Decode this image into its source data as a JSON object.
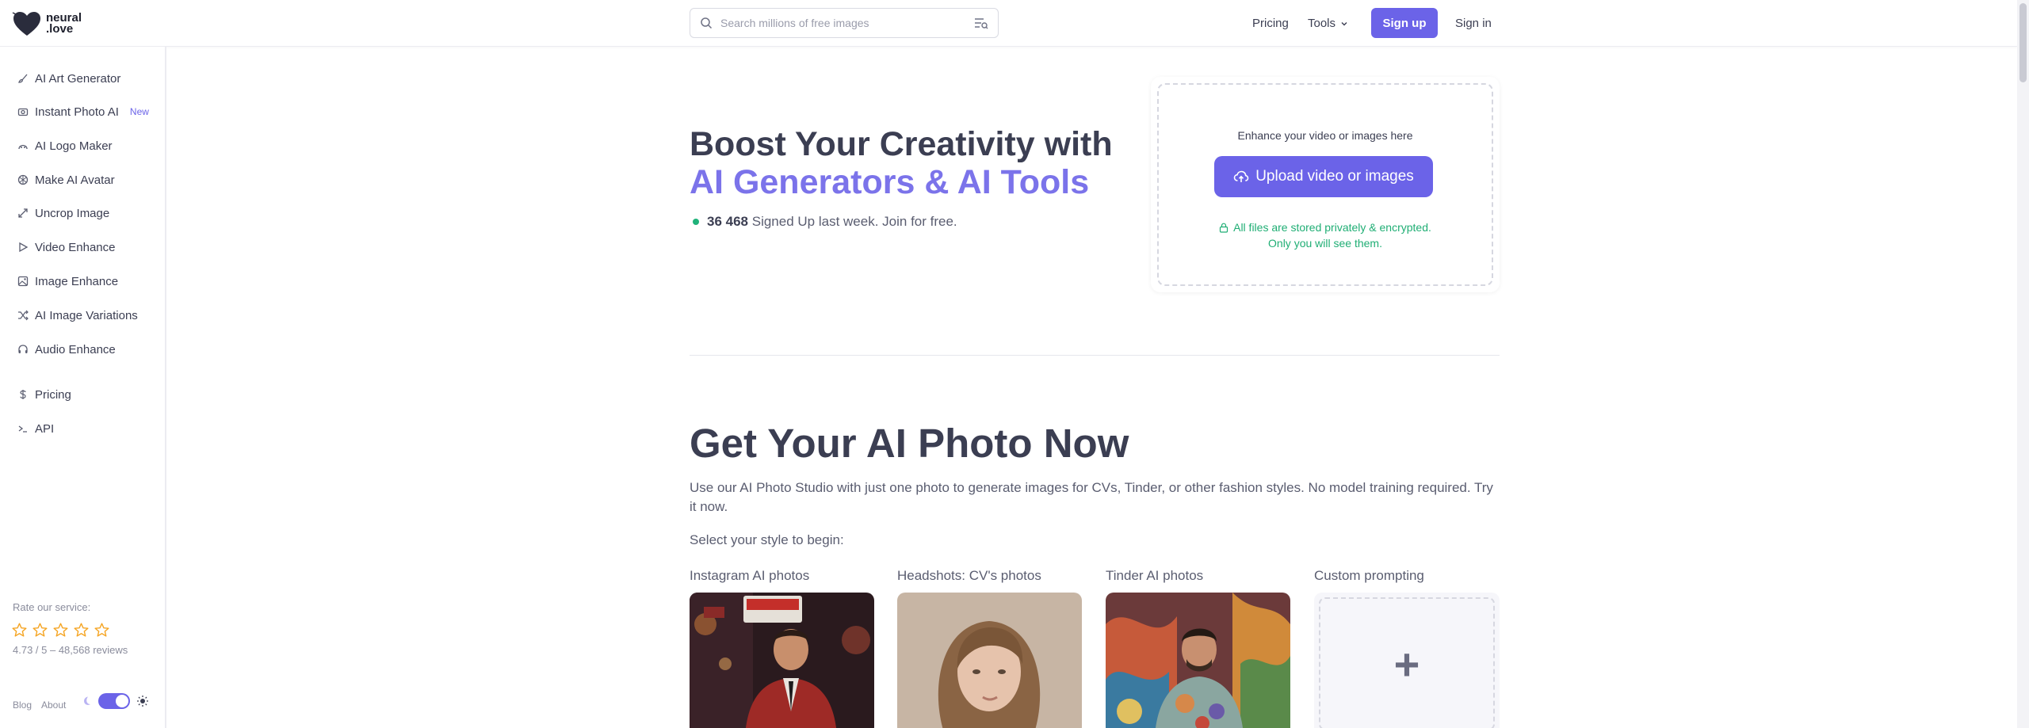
{
  "header": {
    "logo_line1": "neural",
    "logo_line2": ".love",
    "search_placeholder": "Search millions of free images",
    "pricing": "Pricing",
    "tools": "Tools",
    "signup": "Sign up",
    "signin": "Sign in"
  },
  "sidebar": {
    "items": [
      {
        "label": "AI Art Generator",
        "icon": "brush-icon"
      },
      {
        "label": "Instant Photo AI",
        "icon": "camera-icon",
        "badge": "New"
      },
      {
        "label": "AI Logo Maker",
        "icon": "logo-icon"
      },
      {
        "label": "Make AI Avatar",
        "icon": "avatar-icon"
      },
      {
        "label": "Uncrop Image",
        "icon": "expand-icon"
      },
      {
        "label": "Video Enhance",
        "icon": "play-icon"
      },
      {
        "label": "Image Enhance",
        "icon": "image-icon"
      },
      {
        "label": "AI Image Variations",
        "icon": "shuffle-icon"
      },
      {
        "label": "Audio Enhance",
        "icon": "headphones-icon"
      },
      {
        "label": "Pricing",
        "icon": "dollar-icon"
      },
      {
        "label": "API",
        "icon": "terminal-icon"
      }
    ],
    "rate_label": "Rate our service:",
    "rating_text": "4.73 / 5 – 48,568 reviews",
    "rating_stars_total": 5,
    "blog": "Blog",
    "about": "About"
  },
  "hero": {
    "title_line1": "Boost Your Creativity with",
    "title_line2": "AI Generators & AI Tools",
    "signup_count": "36 468",
    "signup_text": "Signed Up last week. Join for free."
  },
  "upload": {
    "hint": "Enhance your video or images here",
    "button": "Upload video or images",
    "privacy_line1": "All files are stored privately & encrypted.",
    "privacy_line2": "Only you will see them."
  },
  "photo_section": {
    "title": "Get Your AI Photo Now",
    "description": "Use our AI Photo Studio with just one photo to generate images for CVs, Tinder, or other fashion styles. No model training required. Try it now.",
    "select_prompt": "Select your style to begin:",
    "cards": [
      {
        "label": "Instagram AI photos"
      },
      {
        "label": "Headshots: CV's photos"
      },
      {
        "label": "Tinder AI photos"
      },
      {
        "label": "Custom prompting",
        "symbol": "+"
      }
    ]
  },
  "colors": {
    "accent": "#6b63e8",
    "title_accent": "#7b73ea",
    "success": "#1fae74",
    "star": "#f5a524"
  }
}
